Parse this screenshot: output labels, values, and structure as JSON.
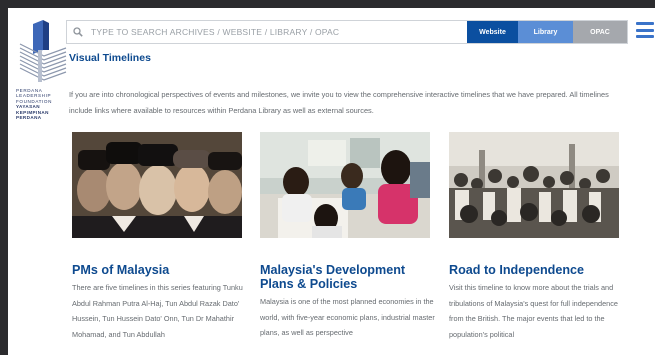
{
  "logo": {
    "lines": [
      "PERDANA",
      "LEADERSHIP",
      "FOUNDATION",
      "YAYASAN",
      "KEPIMPINAN",
      "PERDANA"
    ]
  },
  "search": {
    "placeholder": "TYPE TO SEARCH ARCHIVES / WEBSITE / LIBRARY / OPAC",
    "icon": "search-icon"
  },
  "scopes": [
    {
      "label": "Website",
      "color": "#0b4fa0"
    },
    {
      "label": "Library",
      "color": "#5b8ed6"
    },
    {
      "label": "OPAC",
      "color": "#a5a8ad"
    }
  ],
  "menu_icon": "hamburger-icon",
  "page": {
    "title": "Visual Timelines",
    "intro": "If you are into chronological perspectives of events and milestones, we invite you to view the comprehensive interactive timelines that we have prepared. All timelines include links where available to resources within Perdana Library as well as external sources."
  },
  "cards": [
    {
      "title": "PMs of Malaysia",
      "text": "There are five timelines in this series featuring Tunku Abdul Rahman Putra Al-Haj, Tun Abdul Razak Dato' Hussein, Tun Hussein Dato' Onn, Tun Dr Mahathir Mohamad, and Tun Abdullah"
    },
    {
      "title": "Malaysia's Development Plans & Policies",
      "text": "Malaysia is one of the most planned economies in the world, with five-year economic plans, industrial master plans, as well as perspective"
    },
    {
      "title": "Road to Independence",
      "text": "Visit this timeline to know more about the trials and tribulations of Malaysia's quest for full independence from the British. The major events that led to the population's political"
    }
  ],
  "colors": {
    "brand_blue": "#0e4a8f",
    "accent": "#3a73c9",
    "text_gray": "#666b70"
  }
}
